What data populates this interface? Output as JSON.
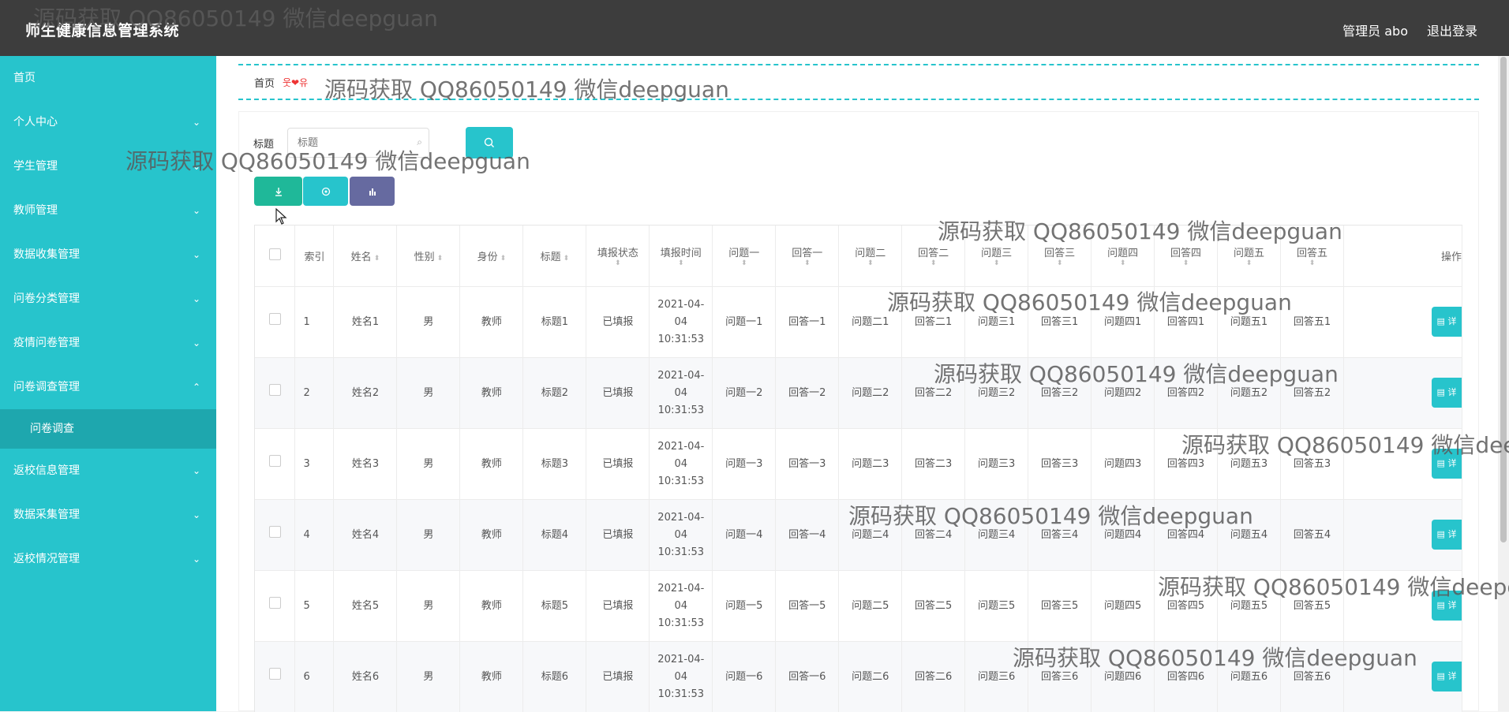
{
  "header": {
    "title": "师生健康信息管理系统",
    "user_label": "管理员 abo",
    "logout_label": "退出登录"
  },
  "sidebar": {
    "items": [
      {
        "label": "首页",
        "chevron": ""
      },
      {
        "label": "个人中心",
        "chevron": "⌄"
      },
      {
        "label": "学生管理",
        "chevron": "⌄"
      },
      {
        "label": "教师管理",
        "chevron": "⌄"
      },
      {
        "label": "数据收集管理",
        "chevron": "⌄"
      },
      {
        "label": "问卷分类管理",
        "chevron": "⌄"
      },
      {
        "label": "疫情问卷管理",
        "chevron": "⌄"
      },
      {
        "label": "问卷调查管理",
        "chevron": "⌃"
      },
      {
        "label": "返校信息管理",
        "chevron": "⌄"
      },
      {
        "label": "数据采集管理",
        "chevron": "⌄"
      },
      {
        "label": "返校情况管理",
        "chevron": "⌄"
      }
    ],
    "sub_item": "问卷调查"
  },
  "breadcrumb": {
    "home": "首页",
    "decoration": "웃❤유"
  },
  "search": {
    "label": "标题",
    "placeholder": "标题"
  },
  "icons": {
    "search": "search-icon",
    "export": "download-icon",
    "print": "print-icon",
    "chart": "bar-chart-icon"
  },
  "table": {
    "headers": [
      "索引",
      "姓名",
      "性别",
      "身份",
      "标题",
      "填报状态",
      "填报时间",
      "问题一",
      "回答一",
      "问题二",
      "回答二",
      "问题三",
      "回答三",
      "问题四",
      "回答四",
      "问题五",
      "回答五",
      "操作"
    ],
    "rows": [
      [
        "1",
        "姓名1",
        "男",
        "教师",
        "标题1",
        "已填报",
        "2021-04-04 10:31:53",
        "问题一1",
        "回答一1",
        "问题二1",
        "回答二1",
        "问题三1",
        "回答三1",
        "问题四1",
        "回答四1",
        "问题五1",
        "回答五1"
      ],
      [
        "2",
        "姓名2",
        "男",
        "教师",
        "标题2",
        "已填报",
        "2021-04-04 10:31:53",
        "问题一2",
        "回答一2",
        "问题二2",
        "回答二2",
        "问题三2",
        "回答三2",
        "问题四2",
        "回答四2",
        "问题五2",
        "回答五2"
      ],
      [
        "3",
        "姓名3",
        "男",
        "教师",
        "标题3",
        "已填报",
        "2021-04-04 10:31:53",
        "问题一3",
        "回答一3",
        "问题二3",
        "回答二3",
        "问题三3",
        "回答三3",
        "问题四3",
        "回答四3",
        "问题五3",
        "回答五3"
      ],
      [
        "4",
        "姓名4",
        "男",
        "教师",
        "标题4",
        "已填报",
        "2021-04-04 10:31:53",
        "问题一4",
        "回答一4",
        "问题二4",
        "回答二4",
        "问题三4",
        "回答三4",
        "问题四4",
        "回答四4",
        "问题五4",
        "回答五4"
      ],
      [
        "5",
        "姓名5",
        "男",
        "教师",
        "标题5",
        "已填报",
        "2021-04-04 10:31:53",
        "问题一5",
        "回答一5",
        "问题二5",
        "回答二5",
        "问题三5",
        "回答三5",
        "问题四5",
        "回答四5",
        "问题五5",
        "回答五5"
      ],
      [
        "6",
        "姓名6",
        "男",
        "教师",
        "标题6",
        "已填报",
        "2021-04-04 10:31:53",
        "问题一6",
        "回答一6",
        "问题二6",
        "回答二6",
        "问题三6",
        "回答三6",
        "问题四6",
        "回答四6",
        "问题五6",
        "回答五6"
      ]
    ],
    "op_label": "详"
  },
  "watermark": "源码获取 QQ86050149 微信deepguan",
  "colors": {
    "accent": "#27c4cc",
    "header": "#3d3d3d",
    "export": "#1fb899",
    "chart": "#666aa0"
  }
}
